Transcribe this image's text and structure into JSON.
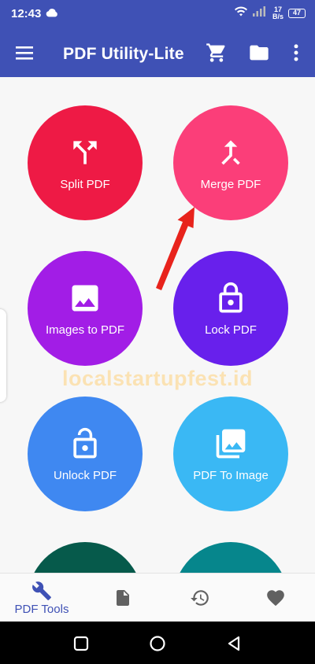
{
  "status_bar": {
    "time": "12:43",
    "net_speed_value": "17",
    "net_speed_unit": "B/s",
    "battery": "47"
  },
  "app_bar": {
    "title": "PDF Utility-Lite"
  },
  "tools": [
    {
      "label": "Split PDF",
      "color": "#ee1a45",
      "icon": "split-icon"
    },
    {
      "label": "Merge PDF",
      "color": "#fb3e79",
      "icon": "merge-icon"
    },
    {
      "label": "Images to PDF",
      "color": "#a21de6",
      "icon": "image-icon"
    },
    {
      "label": "Lock PDF",
      "color": "#6820ec",
      "icon": "lock-icon"
    },
    {
      "label": "Unlock PDF",
      "color": "#3f88f1",
      "icon": "unlock-icon"
    },
    {
      "label": "PDF To Image",
      "color": "#3ab8f4",
      "icon": "photo-library-icon"
    }
  ],
  "partial_tools": [
    {
      "color": "#065a4b"
    },
    {
      "color": "#06868c"
    }
  ],
  "watermark": "localstartupfest.id",
  "bottom_nav": {
    "active_label": "PDF Tools",
    "active_color": "#3f51b5",
    "inactive_color": "#616161"
  },
  "annotation": {
    "arrow_color": "#e8231c"
  }
}
